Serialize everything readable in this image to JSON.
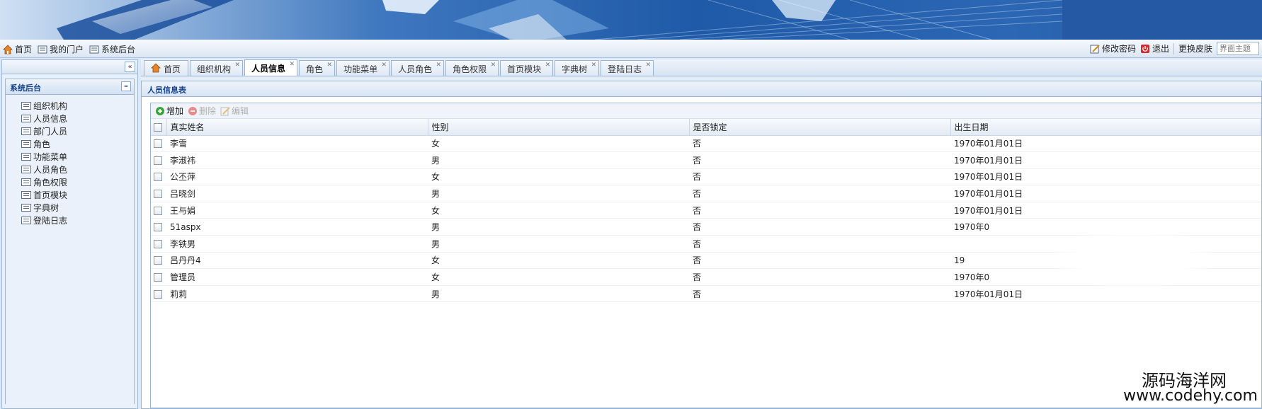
{
  "topbar": {
    "left_items": [
      "首页",
      "我的门户",
      "系统后台"
    ],
    "change_password": "修改密码",
    "logout": "退出",
    "change_skin": "更换皮肤",
    "theme_placeholder": "界面主题"
  },
  "sidebar": {
    "collapse_glyph": "«",
    "section_title": "系统后台",
    "items": [
      "组织机构",
      "人员信息",
      "部门人员",
      "角色",
      "功能菜单",
      "人员角色",
      "角色权限",
      "首页模块",
      "字典树",
      "登陆日志"
    ]
  },
  "tabs": [
    {
      "label": "首页",
      "active": false,
      "closable": false
    },
    {
      "label": "组织机构",
      "active": false,
      "closable": true
    },
    {
      "label": "人员信息",
      "active": true,
      "closable": true
    },
    {
      "label": "角色",
      "active": false,
      "closable": true
    },
    {
      "label": "功能菜单",
      "active": false,
      "closable": true
    },
    {
      "label": "人员角色",
      "active": false,
      "closable": true
    },
    {
      "label": "角色权限",
      "active": false,
      "closable": true
    },
    {
      "label": "首页模块",
      "active": false,
      "closable": true
    },
    {
      "label": "字典树",
      "active": false,
      "closable": true
    },
    {
      "label": "登陆日志",
      "active": false,
      "closable": true
    }
  ],
  "panel": {
    "title": "人员信息表",
    "toolbar": {
      "add": "增加",
      "delete": "删除",
      "edit": "编辑"
    },
    "columns": [
      "真实姓名",
      "性别",
      "是否锁定",
      "出生日期"
    ],
    "rows": [
      [
        "李雪",
        "女",
        "否",
        "1970年01月01日"
      ],
      [
        "李淑祎",
        "男",
        "否",
        "1970年01月01日"
      ],
      [
        "公丕萍",
        "女",
        "否",
        "1970年01月01日"
      ],
      [
        "吕晓剑",
        "男",
        "否",
        "1970年01月01日"
      ],
      [
        "王与娟",
        "女",
        "否",
        "1970年01月01日"
      ],
      [
        "51aspx",
        "男",
        "否",
        "1970年0"
      ],
      [
        "李铁男",
        "男",
        "否",
        ""
      ],
      [
        "吕丹丹4",
        "女",
        "否",
        "19"
      ],
      [
        "管理员",
        "女",
        "否",
        "1970年0"
      ],
      [
        "莉莉",
        "男",
        "否",
        "1970年01月01日"
      ]
    ]
  },
  "watermark": {
    "line1": "源码海洋网",
    "line2": "www.codehy.com"
  },
  "colors": {
    "accent": "#15428b",
    "border": "#98b4d7",
    "banner": "#2559a4"
  }
}
